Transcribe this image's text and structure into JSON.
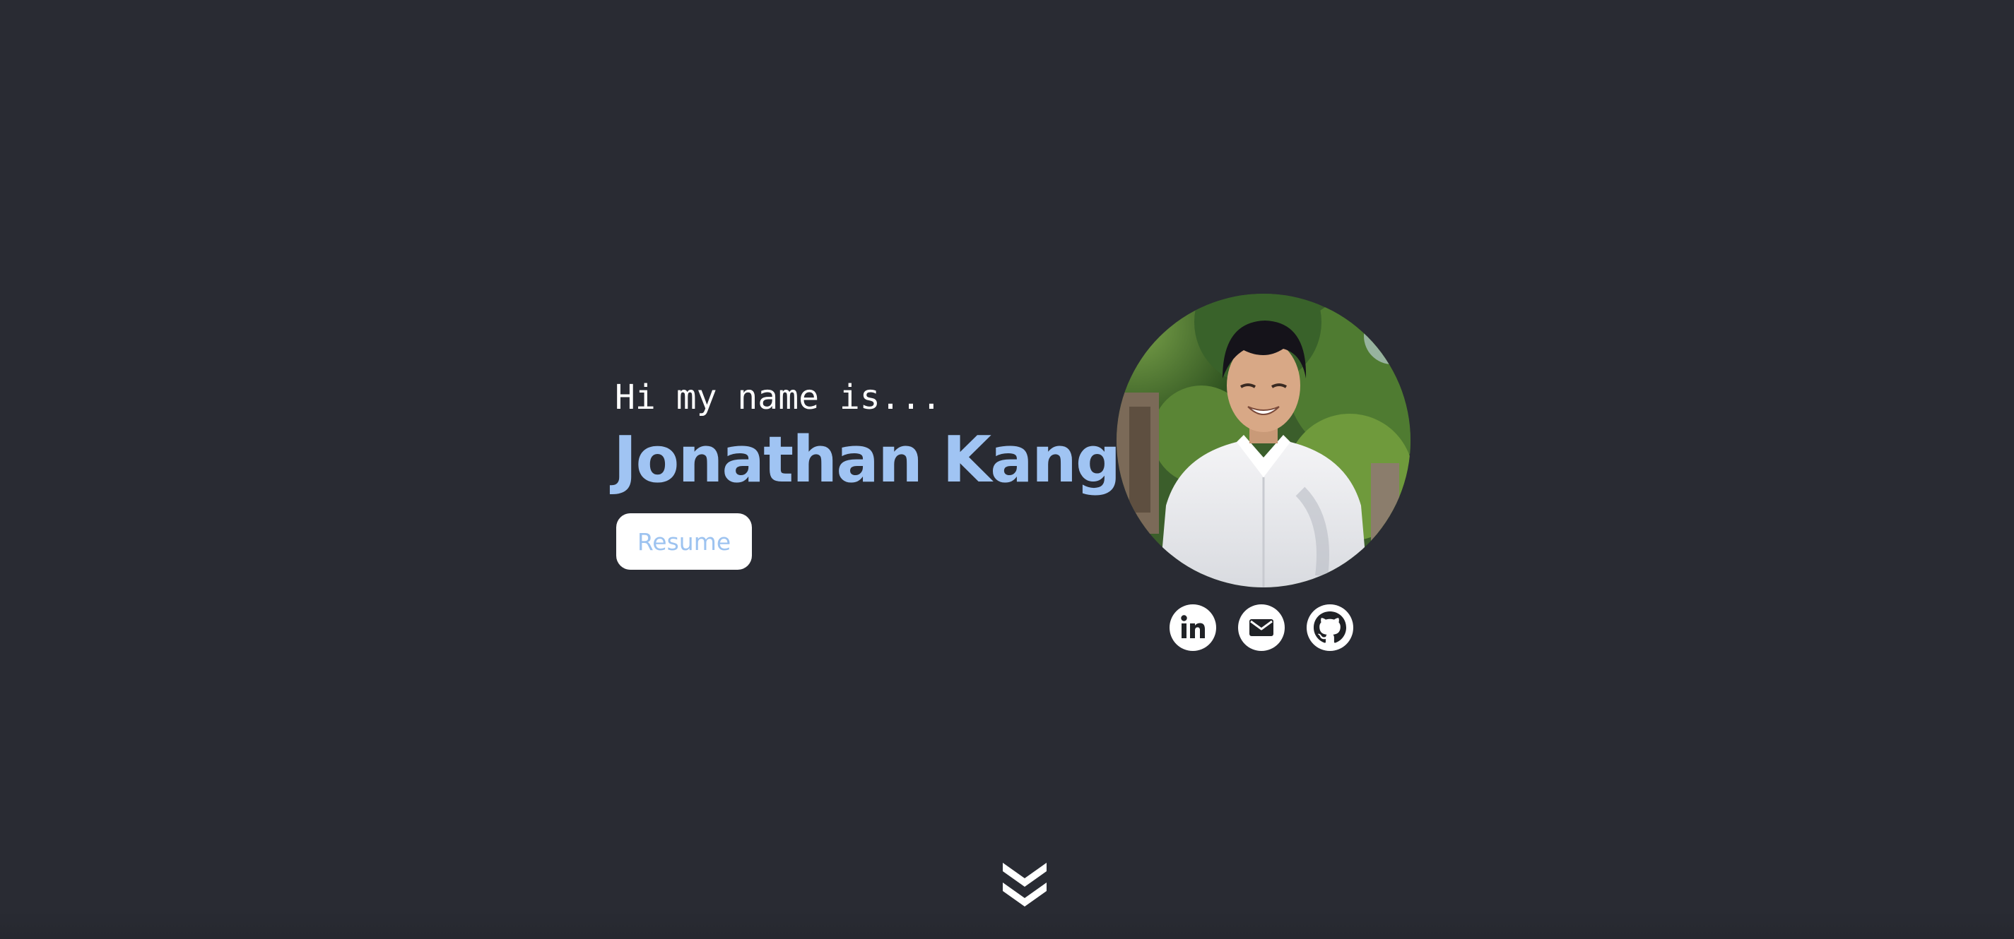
{
  "hero": {
    "greeting": "Hi my name is...",
    "name": "Jonathan Kang",
    "resume_label": "Resume"
  },
  "profile_photo": {
    "alt": "Jonathan Kang"
  },
  "socials": [
    {
      "label": "LinkedIn",
      "icon": "linkedin-icon"
    },
    {
      "label": "Email",
      "icon": "mail-icon"
    },
    {
      "label": "GitHub",
      "icon": "github-icon"
    }
  ],
  "scroll_indicator": {
    "icon": "double-chevron-down-icon"
  },
  "colors": {
    "background": "#292b33",
    "accent": "#a0c4f3",
    "text": "#ffffff"
  }
}
